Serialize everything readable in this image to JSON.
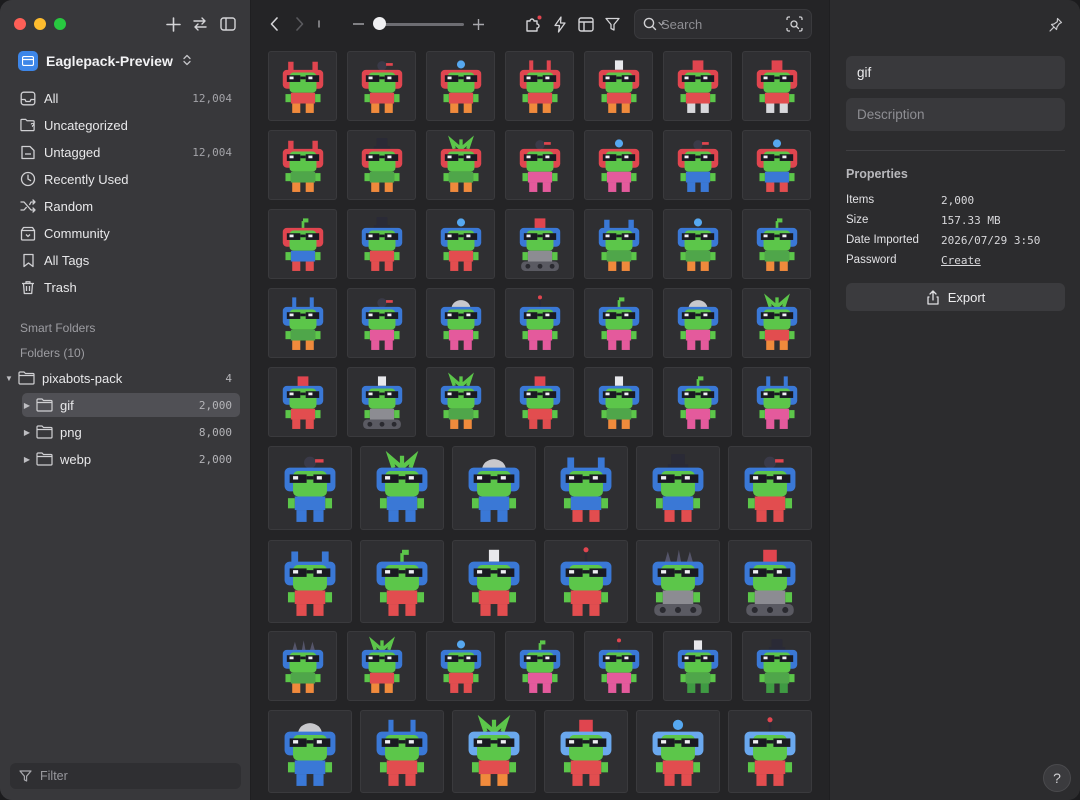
{
  "window": {
    "traffic_colors": [
      "#fe5f57",
      "#febc2e",
      "#28c840"
    ]
  },
  "sidebar": {
    "library_name": "Eaglepack-Preview",
    "nav_items": [
      {
        "label": "All",
        "count": "12,004",
        "icon": "inbox-icon"
      },
      {
        "label": "Uncategorized",
        "count": "",
        "icon": "folder-question-icon"
      },
      {
        "label": "Untagged",
        "count": "12,004",
        "icon": "tag-off-icon"
      },
      {
        "label": "Recently Used",
        "count": "",
        "icon": "clock-icon"
      },
      {
        "label": "Random",
        "count": "",
        "icon": "shuffle-icon"
      },
      {
        "label": "Community",
        "count": "",
        "icon": "community-icon"
      },
      {
        "label": "All Tags",
        "count": "",
        "icon": "bookmark-icon"
      },
      {
        "label": "Trash",
        "count": "",
        "icon": "trash-icon"
      }
    ],
    "smart_folders_label": "Smart Folders",
    "folders_label": "Folders (10)",
    "folders": [
      {
        "label": "pixabots-pack",
        "count": "4",
        "level": 0,
        "expanded": true,
        "selected": false
      },
      {
        "label": "gif",
        "count": "2,000",
        "level": 1,
        "expanded": false,
        "selected": true
      },
      {
        "label": "png",
        "count": "8,000",
        "level": 1,
        "expanded": false,
        "selected": false
      },
      {
        "label": "webp",
        "count": "2,000",
        "level": 1,
        "expanded": false,
        "selected": false
      }
    ],
    "filter_placeholder": "Filter"
  },
  "toolbar": {
    "search_placeholder": "Search",
    "zoom_level": 0.1
  },
  "grid": {
    "thumbnails": [
      {
        "hat": "horns",
        "head": "red",
        "suit": "red",
        "legs": "orange"
      },
      {
        "hat": "bomb",
        "head": "red",
        "suit": "red",
        "legs": "orange"
      },
      {
        "hat": "orb",
        "head": "red",
        "suit": "red",
        "legs": "orange"
      },
      {
        "hat": "antennae",
        "head": "red",
        "suit": "red",
        "legs": "orange"
      },
      {
        "hat": "ghost",
        "head": "red",
        "suit": "red",
        "legs": "orange"
      },
      {
        "hat": "cap",
        "head": "red",
        "suit": "red",
        "legs": "white"
      },
      {
        "hat": "cap",
        "head": "red",
        "suit": "red",
        "legs": "white"
      },
      {
        "hat": "horns",
        "head": "red",
        "suit": "green",
        "legs": "orange"
      },
      {
        "hat": "tophat",
        "head": "red",
        "suit": "green",
        "legs": "orange"
      },
      {
        "hat": "leaves",
        "head": "red",
        "suit": "green",
        "legs": "orange"
      },
      {
        "hat": "bomb",
        "head": "red",
        "suit": "pink",
        "legs": "pink"
      },
      {
        "hat": "orb",
        "head": "red",
        "suit": "pink",
        "legs": "pink"
      },
      {
        "hat": "bomb",
        "head": "red",
        "suit": "blue",
        "legs": "blue"
      },
      {
        "hat": "orb",
        "head": "red",
        "suit": "blue",
        "legs": "red"
      },
      {
        "hat": "sprout",
        "head": "red",
        "suit": "blue",
        "legs": "red"
      },
      {
        "hat": "tophat",
        "head": "blue",
        "suit": "red",
        "legs": "red"
      },
      {
        "hat": "orb",
        "head": "blue",
        "suit": "red",
        "legs": "red"
      },
      {
        "hat": "cap",
        "head": "blue",
        "suit": "gray",
        "legs": "tank"
      },
      {
        "hat": "horns",
        "head": "blue",
        "suit": "green",
        "legs": "orange"
      },
      {
        "hat": "orb",
        "head": "blue",
        "suit": "green",
        "legs": "orange"
      },
      {
        "hat": "sprout",
        "head": "blue",
        "suit": "green",
        "legs": "orange"
      },
      {
        "hat": "antennae",
        "head": "blue",
        "suit": "green",
        "legs": "orange"
      },
      {
        "hat": "bomb",
        "head": "blue",
        "suit": "pink",
        "legs": "pink"
      },
      {
        "hat": "dome",
        "head": "blue",
        "suit": "pink",
        "legs": "pink"
      },
      {
        "hat": "antenna",
        "head": "blue",
        "suit": "pink",
        "legs": "pink"
      },
      {
        "hat": "sprout",
        "head": "blue",
        "suit": "pink",
        "legs": "pink"
      },
      {
        "hat": "dome",
        "head": "blue",
        "suit": "pink",
        "legs": "pink"
      },
      {
        "hat": "leaves",
        "head": "blue",
        "suit": "red",
        "legs": "orange"
      },
      {
        "hat": "cap",
        "head": "blue",
        "suit": "red",
        "legs": "red"
      },
      {
        "hat": "ghost",
        "head": "blue",
        "suit": "gray",
        "legs": "tank"
      },
      {
        "hat": "leaves",
        "head": "blue",
        "suit": "green",
        "legs": "orange"
      },
      {
        "hat": "cap",
        "head": "blue",
        "suit": "red",
        "legs": "red"
      },
      {
        "hat": "ghost",
        "head": "blue",
        "suit": "green",
        "legs": "orange"
      },
      {
        "hat": "sprout",
        "head": "blue",
        "suit": "pink",
        "legs": "pink"
      },
      {
        "hat": "antennae",
        "head": "blue",
        "suit": "pink",
        "legs": "pink"
      },
      {
        "hat": "bomb",
        "head": "blue",
        "suit": "blue",
        "legs": "blue"
      },
      {
        "hat": "leaves",
        "head": "blue",
        "suit": "blue",
        "legs": "blue"
      },
      {
        "hat": "dome",
        "head": "blue",
        "suit": "blue",
        "legs": "blue"
      },
      {
        "hat": "horns",
        "head": "blue",
        "suit": "blue",
        "legs": "red"
      },
      {
        "hat": "tophat",
        "head": "blue",
        "suit": "blue",
        "legs": "red"
      },
      {
        "hat": "bomb",
        "head": "blue",
        "suit": "red",
        "legs": "red"
      },
      {
        "hat": "horns",
        "head": "blue",
        "suit": "red",
        "legs": "red"
      },
      {
        "hat": "sprout",
        "head": "blue",
        "suit": "red",
        "legs": "red"
      },
      {
        "hat": "ghost",
        "head": "blue",
        "suit": "red",
        "legs": "red"
      },
      {
        "hat": "antenna",
        "head": "blue",
        "suit": "red",
        "legs": "red"
      },
      {
        "hat": "spikes",
        "head": "blue",
        "suit": "gray",
        "legs": "tank"
      },
      {
        "hat": "cap",
        "head": "blue",
        "suit": "gray",
        "legs": "tank"
      },
      {
        "hat": "spikes",
        "head": "blue",
        "suit": "green",
        "legs": "orange"
      },
      {
        "hat": "leaves",
        "head": "blue",
        "suit": "red",
        "legs": "orange"
      },
      {
        "hat": "orb",
        "head": "blue",
        "suit": "red",
        "legs": "red"
      },
      {
        "hat": "sprout",
        "head": "blue",
        "suit": "pink",
        "legs": "pink"
      },
      {
        "hat": "antenna",
        "head": "blue",
        "suit": "pink",
        "legs": "pink"
      },
      {
        "hat": "ghost",
        "head": "blue",
        "suit": "green",
        "legs": "green"
      },
      {
        "hat": "tophat",
        "head": "blue",
        "suit": "green",
        "legs": "green"
      },
      {
        "hat": "dome",
        "head": "blue",
        "suit": "blue",
        "legs": "blue"
      },
      {
        "hat": "antennae",
        "head": "blue",
        "suit": "red",
        "legs": "red"
      },
      {
        "hat": "leaves",
        "head": "lightblue",
        "suit": "red",
        "legs": "orange"
      },
      {
        "hat": "cap",
        "head": "lightblue",
        "suit": "red",
        "legs": "red"
      },
      {
        "hat": "orb",
        "head": "lightblue",
        "suit": "red",
        "legs": "red"
      },
      {
        "hat": "antenna",
        "head": "lightblue",
        "suit": "red",
        "legs": "red"
      }
    ]
  },
  "inspector": {
    "name_value": "gif",
    "description_placeholder": "Description",
    "properties_title": "Properties",
    "properties": [
      {
        "key": "Items",
        "value": "2,000",
        "link": false
      },
      {
        "key": "Size",
        "value": "157.33 MB",
        "link": false
      },
      {
        "key": "Date Imported",
        "value": "2026/07/29 3:50",
        "link": false
      },
      {
        "key": "Password",
        "value": "Create",
        "link": true
      }
    ],
    "export_label": "Export",
    "help_label": "?"
  },
  "colors": {
    "accent": "#3d86e8",
    "bot_green": "#5cc64a",
    "head_red": "#e0454f",
    "head_blue": "#3a78d6",
    "head_lightblue": "#6aa8ee"
  }
}
